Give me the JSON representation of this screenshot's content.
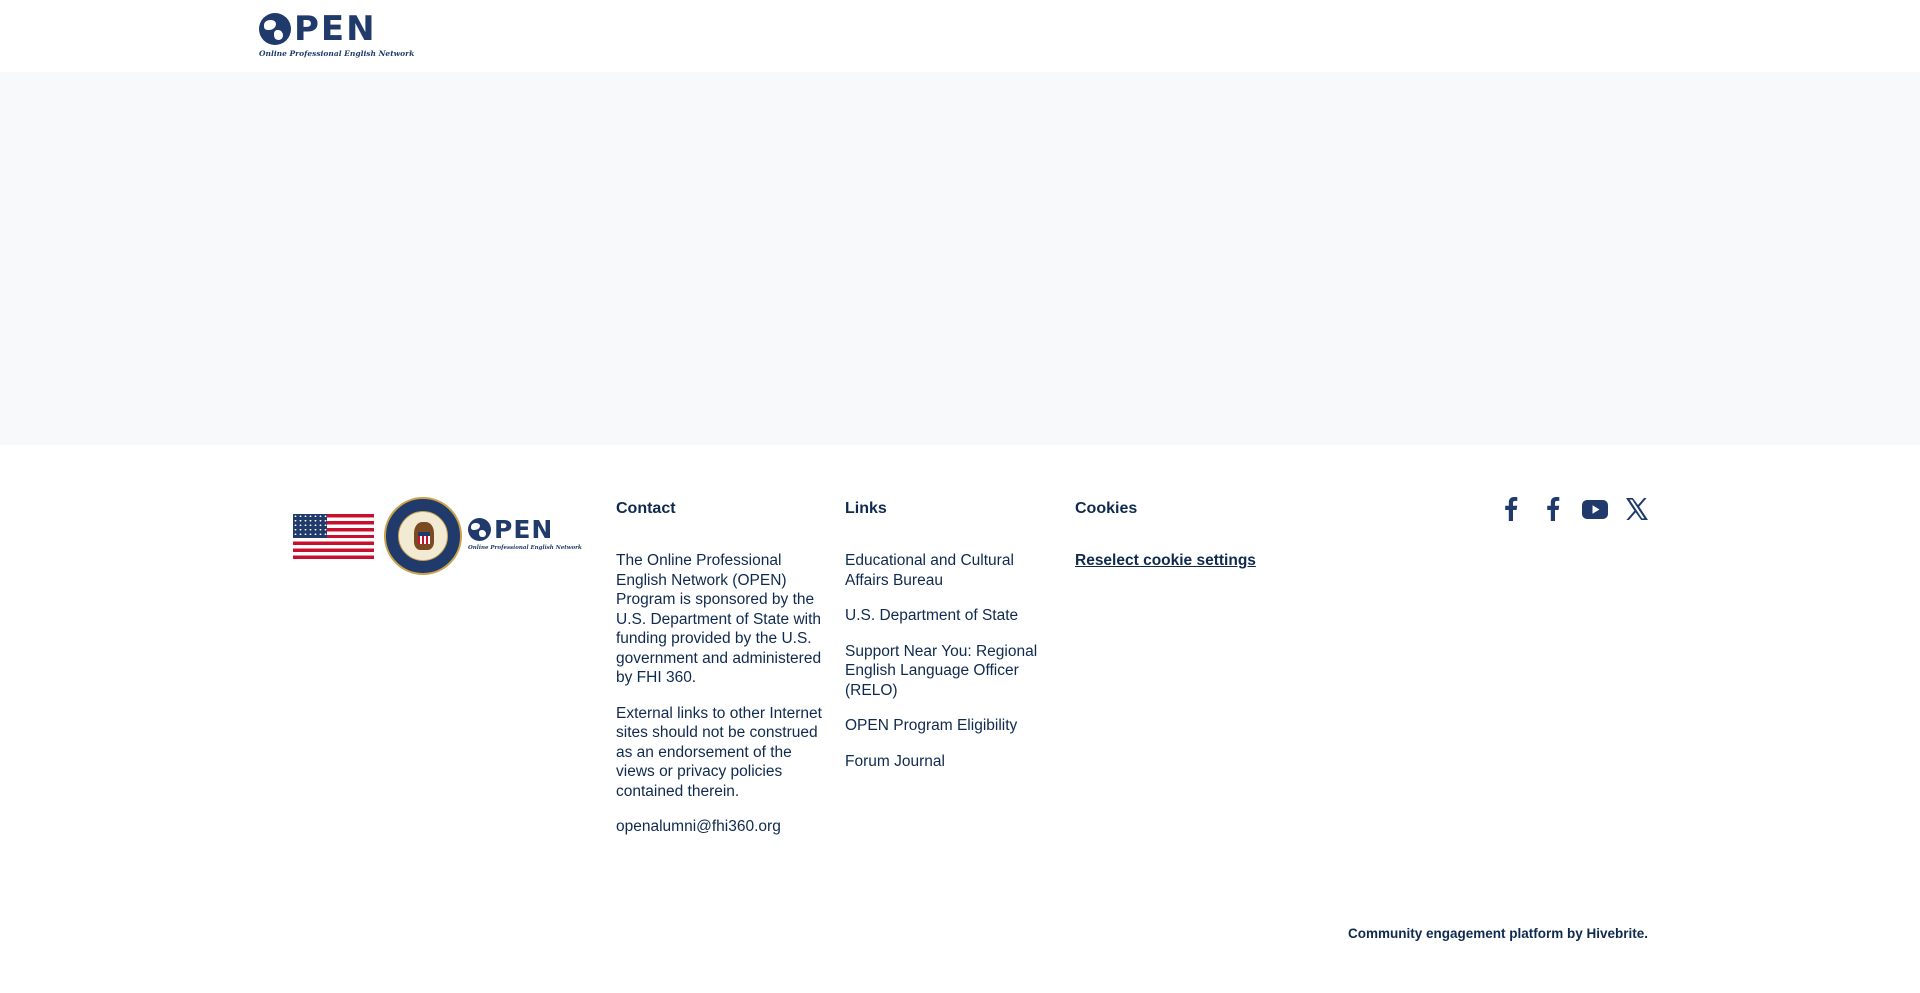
{
  "header": {
    "logo": {
      "word": "PEN",
      "tagline": "Online Professional English Network"
    }
  },
  "footer": {
    "logos": {
      "open_word": "PEN",
      "open_tagline": "Online Professional English Network"
    },
    "contact": {
      "heading": "Contact",
      "paragraphs": [
        "The Online Professional English Network (OPEN) Program is sponsored by the U.S. Department of State with funding provided by the U.S. government and administered by FHI 360.",
        "External links to other Internet sites should not be construed as an endorsement of the views or privacy policies contained therein."
      ],
      "email": "openalumni@fhi360.org"
    },
    "links": {
      "heading": "Links",
      "items": [
        "Educational and Cultural Affairs Bureau",
        "U.S. Department of State",
        "Support Near You: Regional English Language Officer (RELO)",
        "OPEN Program Eligibility",
        "Forum Journal"
      ]
    },
    "cookies": {
      "heading": "Cookies",
      "reselect_label": "Reselect cookie settings"
    },
    "socials": [
      "facebook-icon",
      "facebook-icon",
      "youtube-icon",
      "x-icon"
    ],
    "powered_by": "Community engagement platform by Hivebrite."
  },
  "colors": {
    "brand_navy": "#1f3a6b",
    "text": "#0f2a4f",
    "main_bg": "#f8f9fb"
  }
}
